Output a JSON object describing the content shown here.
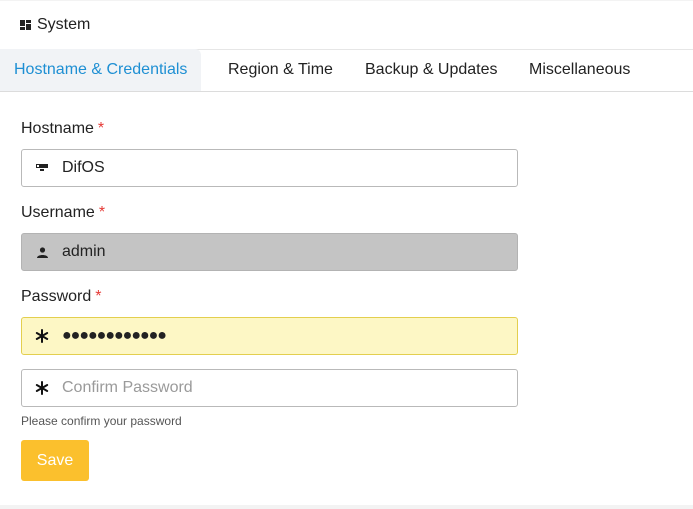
{
  "header": {
    "title": "System",
    "icon": "dashboard-icon"
  },
  "tabs": [
    {
      "label": "Hostname & Credentials",
      "active": true
    },
    {
      "label": "Region & Time",
      "active": false
    },
    {
      "label": "Backup & Updates",
      "active": false
    },
    {
      "label": "Miscellaneous",
      "active": false
    }
  ],
  "form": {
    "hostname": {
      "label": "Hostname",
      "required_mark": "*",
      "value": "DifOS",
      "icon": "server-icon"
    },
    "username": {
      "label": "Username",
      "required_mark": "*",
      "value": "admin",
      "icon": "user-icon",
      "disabled": true
    },
    "password": {
      "label": "Password",
      "required_mark": "*",
      "value": "●●●●●●●●●●●●",
      "icon": "asterisk-icon"
    },
    "confirm_password": {
      "placeholder": "Confirm Password",
      "value": "",
      "icon": "asterisk-icon",
      "help": "Please confirm your password"
    },
    "save_label": "Save"
  },
  "colors": {
    "accent": "#1e8fd3",
    "required": "#e53935",
    "save_button": "#fbc02d",
    "password_focus_bg": "#fdf7c5"
  }
}
